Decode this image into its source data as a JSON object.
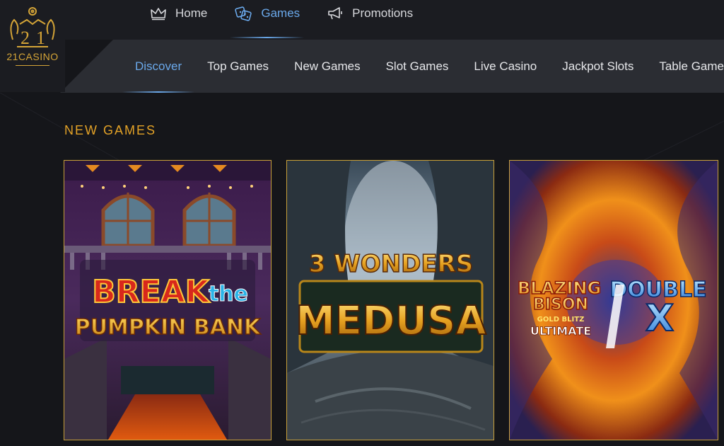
{
  "logo": {
    "text": "21CASINO"
  },
  "main_nav": [
    {
      "label": "Home",
      "icon": "crown-icon",
      "active": false
    },
    {
      "label": "Games",
      "icon": "dice-icon",
      "active": true
    },
    {
      "label": "Promotions",
      "icon": "megaphone-icon",
      "active": false
    }
  ],
  "sub_nav": [
    {
      "label": "Discover",
      "active": true
    },
    {
      "label": "Top Games",
      "active": false
    },
    {
      "label": "New Games",
      "active": false
    },
    {
      "label": "Slot Games",
      "active": false
    },
    {
      "label": "Live Casino",
      "active": false
    },
    {
      "label": "Jackpot Slots",
      "active": false
    },
    {
      "label": "Table Games",
      "active": false
    }
  ],
  "section": {
    "title": "NEW GAMES",
    "games": [
      {
        "line1": "BREAK",
        "line2": "the",
        "line3": "PUMPKIN BANK"
      },
      {
        "line1": "3 WONDERS",
        "line2": "MEDUSA"
      },
      {
        "line1": "BLAZING",
        "line2": "BISON",
        "line3": "GOLD BLITZ",
        "line4": "ULTIMATE",
        "line5": "DOUBLE",
        "line6": "X"
      }
    ]
  },
  "colors": {
    "accent": "#6aa8ea",
    "gold": "#e3a227",
    "background": "#15161a"
  }
}
